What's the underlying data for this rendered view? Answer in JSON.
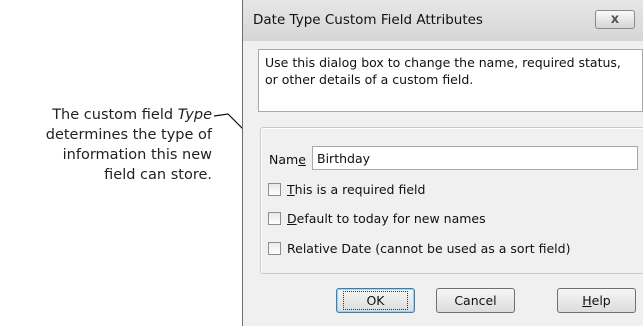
{
  "callout": {
    "line1_prefix": "The custom field ",
    "line1_emph": "Type",
    "line2": "determines the type of",
    "line3": "information this new",
    "line4": "field can store."
  },
  "dialog": {
    "title": "Date Type Custom Field Attributes",
    "close_glyph": "x",
    "description": "Use this dialog box to change the name, required status, or other details of a custom field.",
    "name_label_pre": "Nam",
    "name_label_key": "e",
    "name_value": "Birthday",
    "checkboxes": [
      {
        "key": "T",
        "rest": "his is a required field",
        "checked": false
      },
      {
        "key": "D",
        "rest": "efault to today for new names",
        "checked": false
      },
      {
        "key": "",
        "rest": "Relative Date (cannot be used as a sort field)",
        "checked": false
      }
    ],
    "buttons": {
      "ok": "OK",
      "cancel": "Cancel",
      "help_key": "H",
      "help_rest": "elp"
    }
  }
}
